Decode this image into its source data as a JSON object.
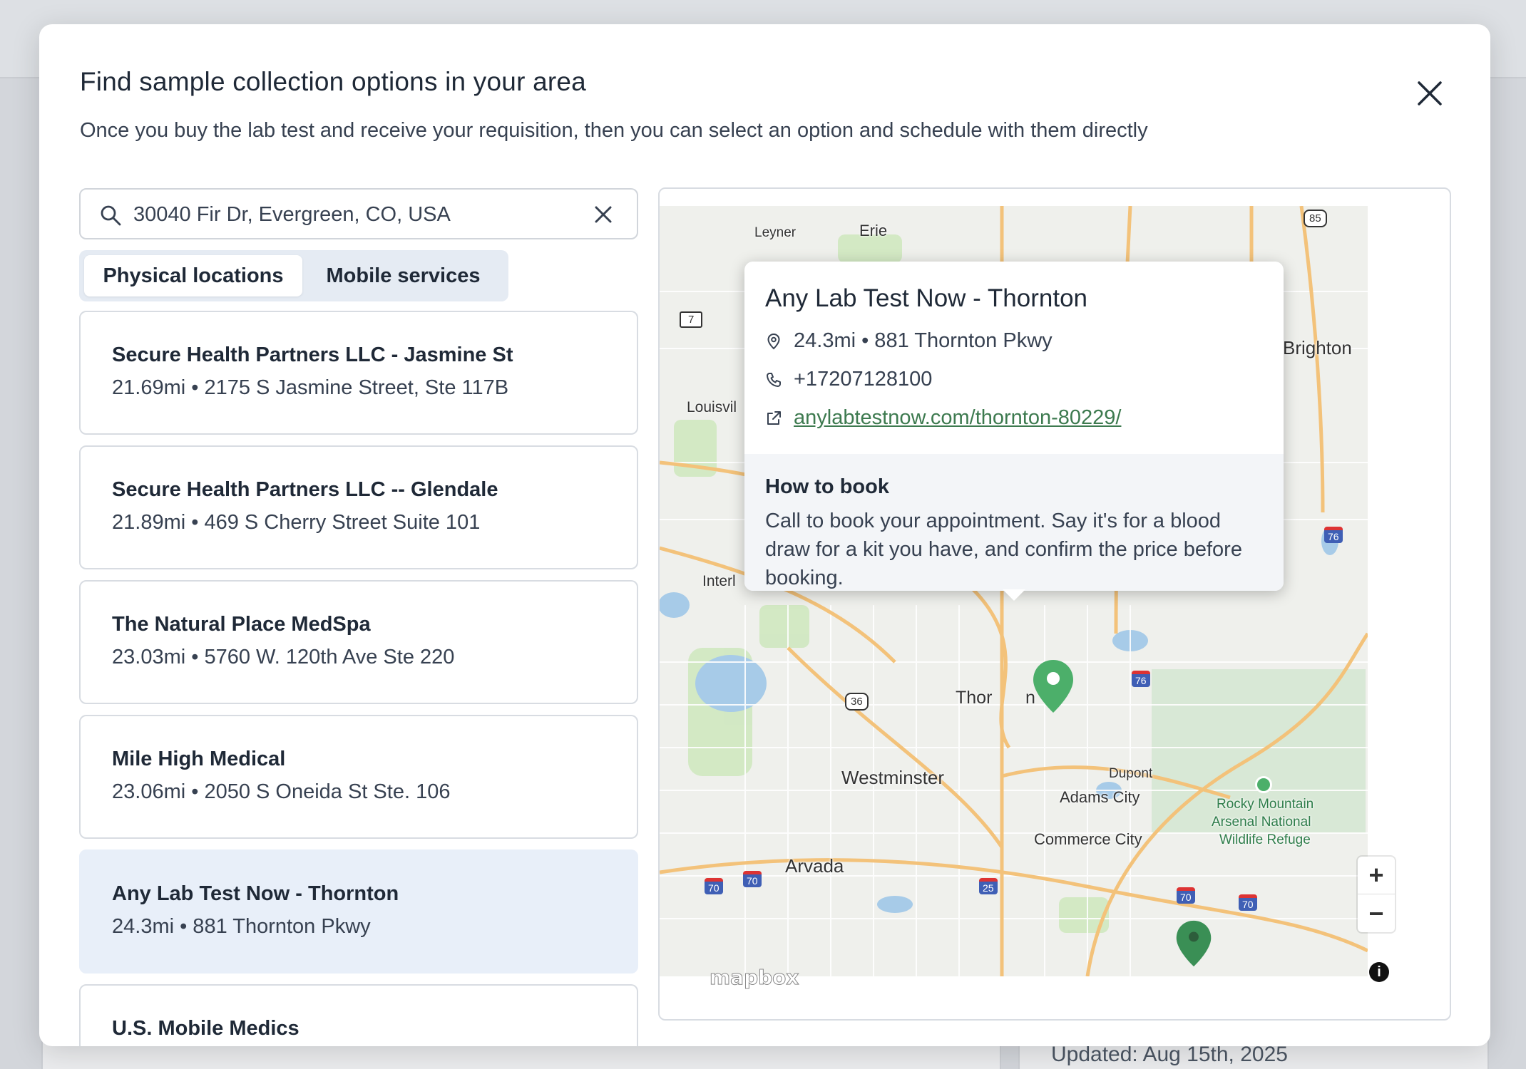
{
  "modal": {
    "title": "Find sample collection options in your area",
    "subtitle": "Once you buy the lab test and receive your requisition, then you can select an option and schedule with them directly"
  },
  "search": {
    "value": "30040 Fir Dr, Evergreen, CO, USA",
    "placeholder": ""
  },
  "tabs": [
    {
      "label": "Physical locations",
      "active": true
    },
    {
      "label": "Mobile services",
      "active": false
    }
  ],
  "locations": [
    {
      "name": "Secure Health Partners LLC - Jasmine St",
      "meta": "21.69mi • 2175 S Jasmine Street, Ste 117B"
    },
    {
      "name": "Secure Health Partners LLC -- Glendale",
      "meta": "21.89mi • 469 S Cherry Street Suite 101"
    },
    {
      "name": "The Natural Place MedSpa",
      "meta": "23.03mi • 5760 W. 120th Ave Ste 220"
    },
    {
      "name": "Mile High Medical",
      "meta": "23.06mi • 2050 S Oneida St Ste. 106"
    },
    {
      "name": "Any Lab Test Now - Thornton",
      "meta": "24.3mi • 881 Thornton Pkwy",
      "selected": true
    },
    {
      "name": "U.S. Mobile Medics",
      "meta": ""
    }
  ],
  "popup": {
    "title": "Any Lab Test Now - Thornton",
    "address": "24.3mi • 881 Thornton Pkwy",
    "phone": "+17207128100",
    "link": "anylabtestnow.com/thornton-80229/",
    "how_to_book_heading": "How to book",
    "how_to_book_text": "Call to book your appointment. Say it's for a blood draw for a kit you have, and confirm the price before booking."
  },
  "map": {
    "labels": {
      "leyner": "Leyner",
      "erie": "Erie",
      "louisville": "Louisvil",
      "interlocken": "Interl",
      "brighton": "Brighton",
      "thornton_a": "Thor",
      "thornton_b": "n",
      "westminster": "Westminster",
      "dupont": "Dupont",
      "adams_city": "Adams City",
      "commerce_city": "Commerce City",
      "arvada": "Arvada",
      "rocky_1": "Rocky Mountain",
      "rocky_2": "Arsenal National",
      "rocky_3": "Wildlife Refuge"
    },
    "shields": {
      "us85": "85",
      "sh7": "7",
      "us36": "36",
      "i76a": "76",
      "i76b": "76",
      "i25": "25",
      "i70a": "70",
      "i70b": "70",
      "i70c": "70",
      "i70d": "70"
    },
    "attribution": "mapbox",
    "zoom_in": "+",
    "zoom_out": "−",
    "info": "i"
  },
  "background": {
    "updated": "Updated: Aug 15th, 2025"
  },
  "colors": {
    "accent_green": "#4caf6a",
    "selected_bg": "#e8eff9",
    "link": "#3d7a4f"
  }
}
